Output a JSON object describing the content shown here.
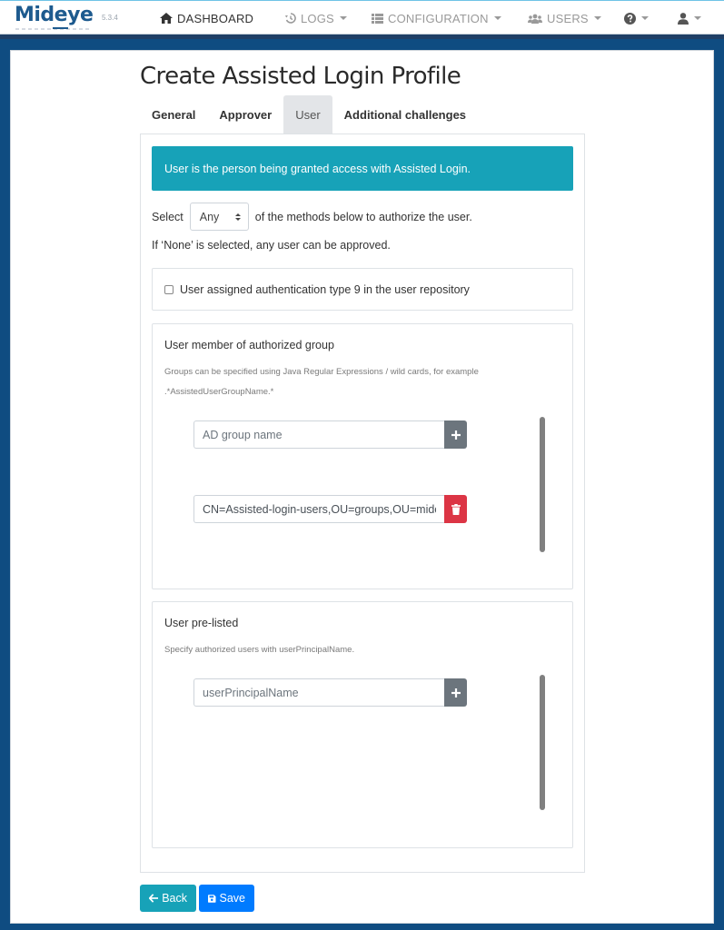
{
  "app": {
    "brand": "Mideye",
    "version": "5.3.4"
  },
  "nav": {
    "items": [
      {
        "label": "DASHBOARD",
        "icon": "home-icon",
        "has_caret": false
      },
      {
        "label": "LOGS",
        "icon": "history-icon",
        "has_caret": true
      },
      {
        "label": "CONFIGURATION",
        "icon": "list-icon",
        "has_caret": true
      },
      {
        "label": "USERS",
        "icon": "users-icon",
        "has_caret": true
      },
      {
        "label": "",
        "icon": "question-circle-icon",
        "has_caret": true
      },
      {
        "label": "",
        "icon": "user-icon",
        "has_caret": true
      }
    ]
  },
  "page": {
    "title": "Create Assisted Login Profile"
  },
  "tabs": [
    {
      "label": "General",
      "active": false
    },
    {
      "label": "Approver",
      "active": false
    },
    {
      "label": "User",
      "active": true
    },
    {
      "label": "Additional challenges",
      "active": false
    }
  ],
  "user_tab": {
    "info_text": "User is the person being granted access with Assisted Login.",
    "select_prefix": "Select",
    "select_value": "Any",
    "select_suffix": "of the methods below to authorize the user.",
    "none_note": "If ‘None’ is selected, any user can be approved.",
    "auth_type_checkbox": {
      "label": "User assigned authentication type 9 in the user repository",
      "checked": false
    },
    "group_section": {
      "title": "User member of authorized group",
      "hint_line1": "Groups can be specified using Java Regular Expressions / wild cards, for example",
      "hint_line2": ".*AssistedUserGroupName.*",
      "new_input_placeholder": "AD group name",
      "entries": [
        {
          "value": "CN=Assisted-login-users,OU=groups,OU=mideye"
        }
      ]
    },
    "prelisted_section": {
      "title": "User pre-listed",
      "hint": "Specify authorized users with userPrincipalName.",
      "new_input_placeholder": "userPrincipalName",
      "entries": []
    }
  },
  "footer_buttons": {
    "back": "Back",
    "save": "Save"
  },
  "colors": {
    "info": "#17a2b8",
    "primary": "#007bff",
    "danger": "#dc3545",
    "secondary": "#6c757d",
    "brand": "#1d5a8e",
    "page_background": "#0f4c81"
  }
}
